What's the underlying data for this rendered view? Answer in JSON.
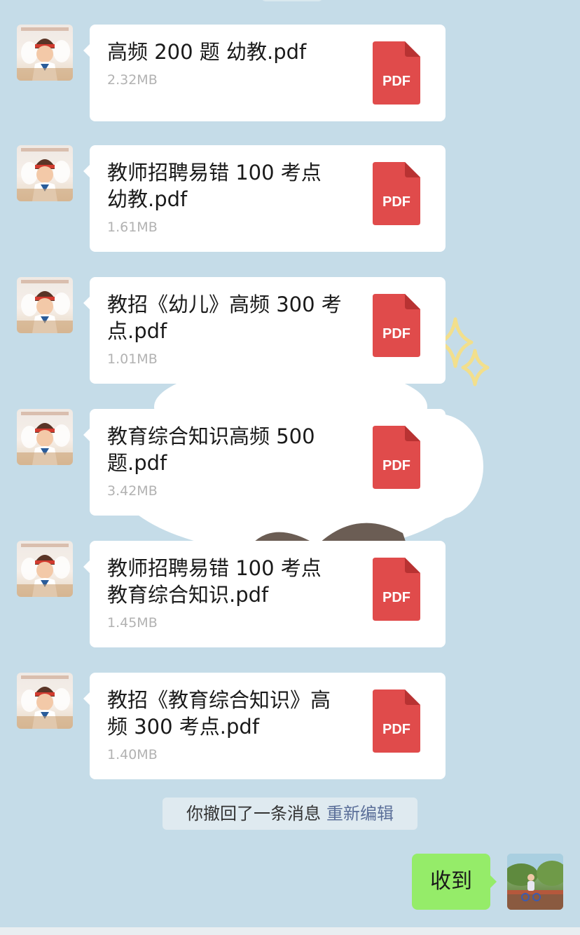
{
  "messages": [
    {
      "name": "高频 200 题 幼教.pdf",
      "size": "2.32MB"
    },
    {
      "name": "教师招聘易错 100 考点 幼教.pdf",
      "size": "1.61MB"
    },
    {
      "name": "教招《幼儿》高频 300 考点.pdf",
      "size": "1.01MB"
    },
    {
      "name": "教育综合知识高频 500 题.pdf",
      "size": "3.42MB"
    },
    {
      "name": "教师招聘易错 100 考点 教育综合知识.pdf",
      "size": "1.45MB"
    },
    {
      "name": "教招《教育综合知识》高频 300 考点.pdf",
      "size": "1.40MB"
    }
  ],
  "pdf_label": "PDF",
  "recall": {
    "text": "你撤回了一条消息",
    "edit": "重新编辑"
  },
  "my_message": "收到",
  "colors": {
    "background": "#c5dce8",
    "pdf_red": "#e04b4b",
    "my_bubble": "#95ec69",
    "link": "#5b6f99"
  }
}
